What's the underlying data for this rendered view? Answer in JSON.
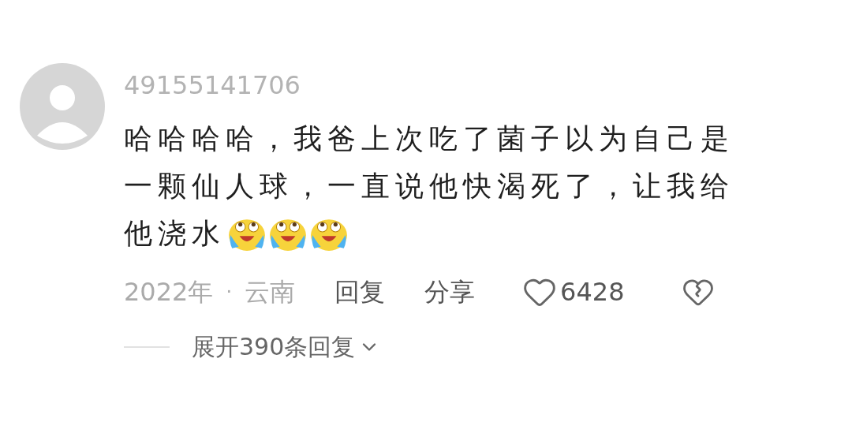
{
  "comment": {
    "username": "49155141706",
    "lines": [
      "哈哈哈哈，我爸上次吃了菌子以为自己是",
      "一颗仙人球，一直说他快渴死了，让我给",
      "他浇水"
    ],
    "emojis": [
      {
        "kind": "crying-laughing"
      },
      {
        "kind": "crying-laughing"
      },
      {
        "kind": "crying-laughing"
      }
    ],
    "time": "2022年",
    "separator": "·",
    "location": "云南",
    "reply": "回复",
    "share": "分享",
    "likes": "6428",
    "liked": false,
    "expand": "展开390条回复"
  }
}
